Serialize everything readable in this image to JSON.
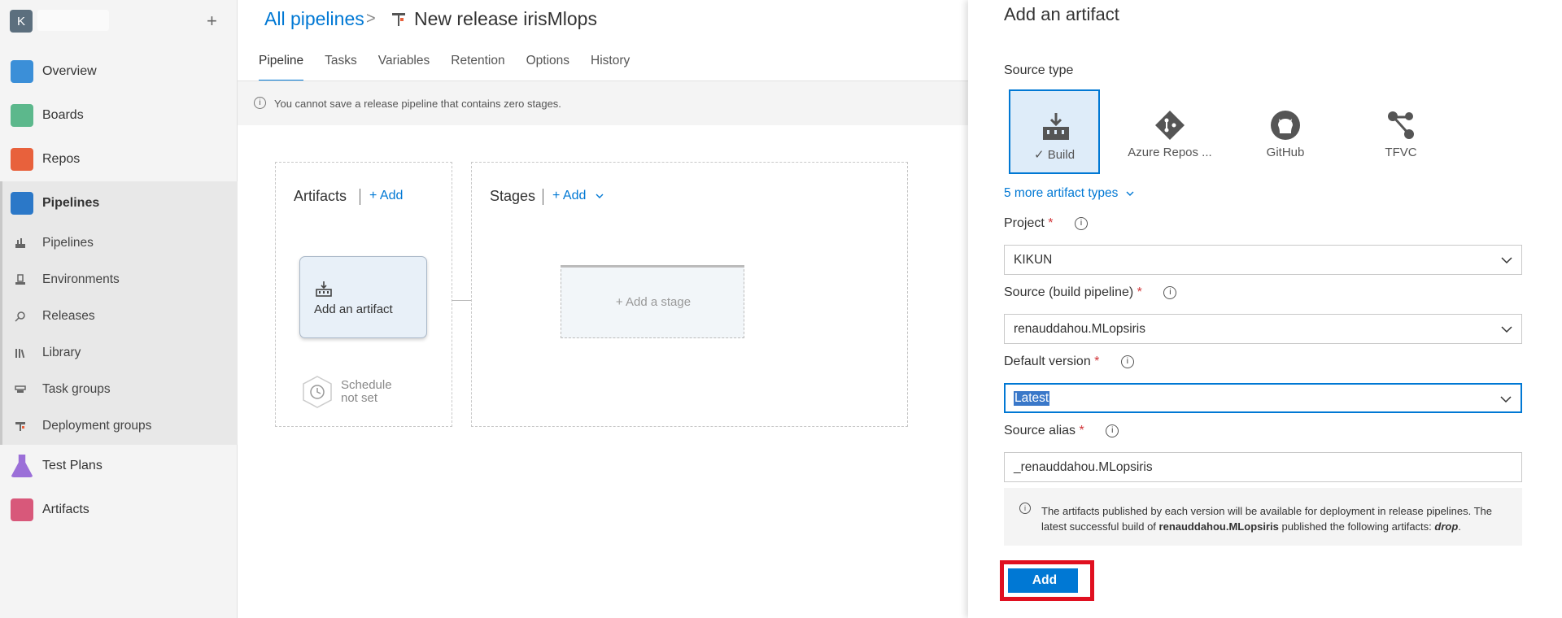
{
  "nav": {
    "org_initial": "K",
    "add_symbol": "+",
    "items": [
      {
        "label": "Overview",
        "color": "#2b88d8"
      },
      {
        "label": "Boards",
        "color": "#5cb85c"
      },
      {
        "label": "Repos",
        "color": "#e8613c"
      },
      {
        "label": "Pipelines",
        "color": "#2b78c8"
      },
      {
        "label": "Test Plans",
        "color": "#8b5fc8"
      },
      {
        "label": "Artifacts",
        "color": "#d8587a"
      }
    ],
    "sub_items": [
      {
        "label": "Pipelines",
        "icon": "pipelines-icon"
      },
      {
        "label": "Environments",
        "icon": "environments-icon"
      },
      {
        "label": "Releases",
        "icon": "releases-icon"
      },
      {
        "label": "Library",
        "icon": "library-icon"
      },
      {
        "label": "Task groups",
        "icon": "task-groups-icon"
      },
      {
        "label": "Deployment groups",
        "icon": "deployment-groups-icon"
      }
    ]
  },
  "header": {
    "breadcrumb_root": "All pipelines",
    "breadcrumb_separator": ">",
    "title": "New release irisMlops",
    "tabs": [
      "Pipeline",
      "Tasks",
      "Variables",
      "Retention",
      "Options",
      "History"
    ],
    "active_tab": "Pipeline",
    "banner_icon": "i",
    "banner": "You cannot save a release pipeline that contains zero stages."
  },
  "canvas": {
    "artifacts_title": "Artifacts",
    "artifacts_add": "+ Add",
    "add_artifact_card": "Add an artifact",
    "schedule_line1": "Schedule",
    "schedule_line2": "not set",
    "stages_title": "Stages",
    "stages_add": "+ Add",
    "add_stage": "+ Add a stage"
  },
  "panel": {
    "title": "Add an artifact",
    "source_type_label": "Source type",
    "source_types": [
      {
        "label": "✓ Build",
        "icon": "build-icon",
        "selected": true
      },
      {
        "label": "Azure Repos ...",
        "icon": "azure-repos-icon",
        "selected": false
      },
      {
        "label": "GitHub",
        "icon": "github-icon",
        "selected": false
      },
      {
        "label": "TFVC",
        "icon": "tfvc-icon",
        "selected": false
      }
    ],
    "more_types": "5 more artifact types",
    "required_mark": "*",
    "info_glyph": "i",
    "project_label": "Project",
    "project_value": "KIKUN",
    "source_label": "Source (build pipeline)",
    "source_value": "renauddahou.MLopsiris",
    "version_label": "Default version",
    "version_value": "Latest",
    "alias_label": "Source alias",
    "alias_value": "_renauddahou.MLopsiris",
    "note_part1": "The artifacts published by each version will be available for deployment in release pipelines. The latest successful build of",
    "note_bold": "renauddahou.MLopsiris",
    "note_part2": "published the following artifacts:",
    "note_artifact": "drop",
    "note_end": ".",
    "add_button": "Add",
    "accent_color": "#0078d4",
    "highlight_color": "#e01020"
  }
}
